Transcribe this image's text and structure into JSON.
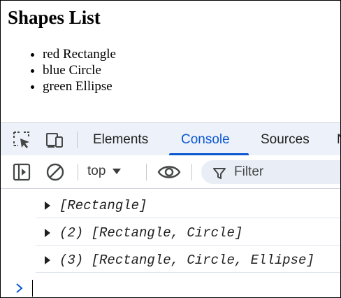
{
  "page": {
    "title": "Shapes List",
    "items": [
      {
        "label": "red Rectangle"
      },
      {
        "label": "blue Circle"
      },
      {
        "label": "green Ellipse"
      }
    ]
  },
  "devtools": {
    "tabs": [
      {
        "label": "Elements",
        "active": false
      },
      {
        "label": "Console",
        "active": true
      },
      {
        "label": "Sources",
        "active": false
      },
      {
        "label": "N",
        "active": false
      }
    ],
    "icons": [
      "inspect-element-icon",
      "device-toolbar-icon"
    ],
    "accent_color": "#0b57d0"
  },
  "console": {
    "toolbar": {
      "icons": [
        "sidebar-toggle-icon",
        "clear-console-icon",
        "live-expression-eye-icon",
        "filter-icon"
      ],
      "context": "top",
      "filter_placeholder": "Filter"
    },
    "messages": [
      {
        "text": "[Rectangle]"
      },
      {
        "text": "(2) [Rectangle, Circle]"
      },
      {
        "text": "(3) [Rectangle, Circle, Ellipse]"
      }
    ],
    "prompt_icon": "prompt-chevron-icon"
  }
}
